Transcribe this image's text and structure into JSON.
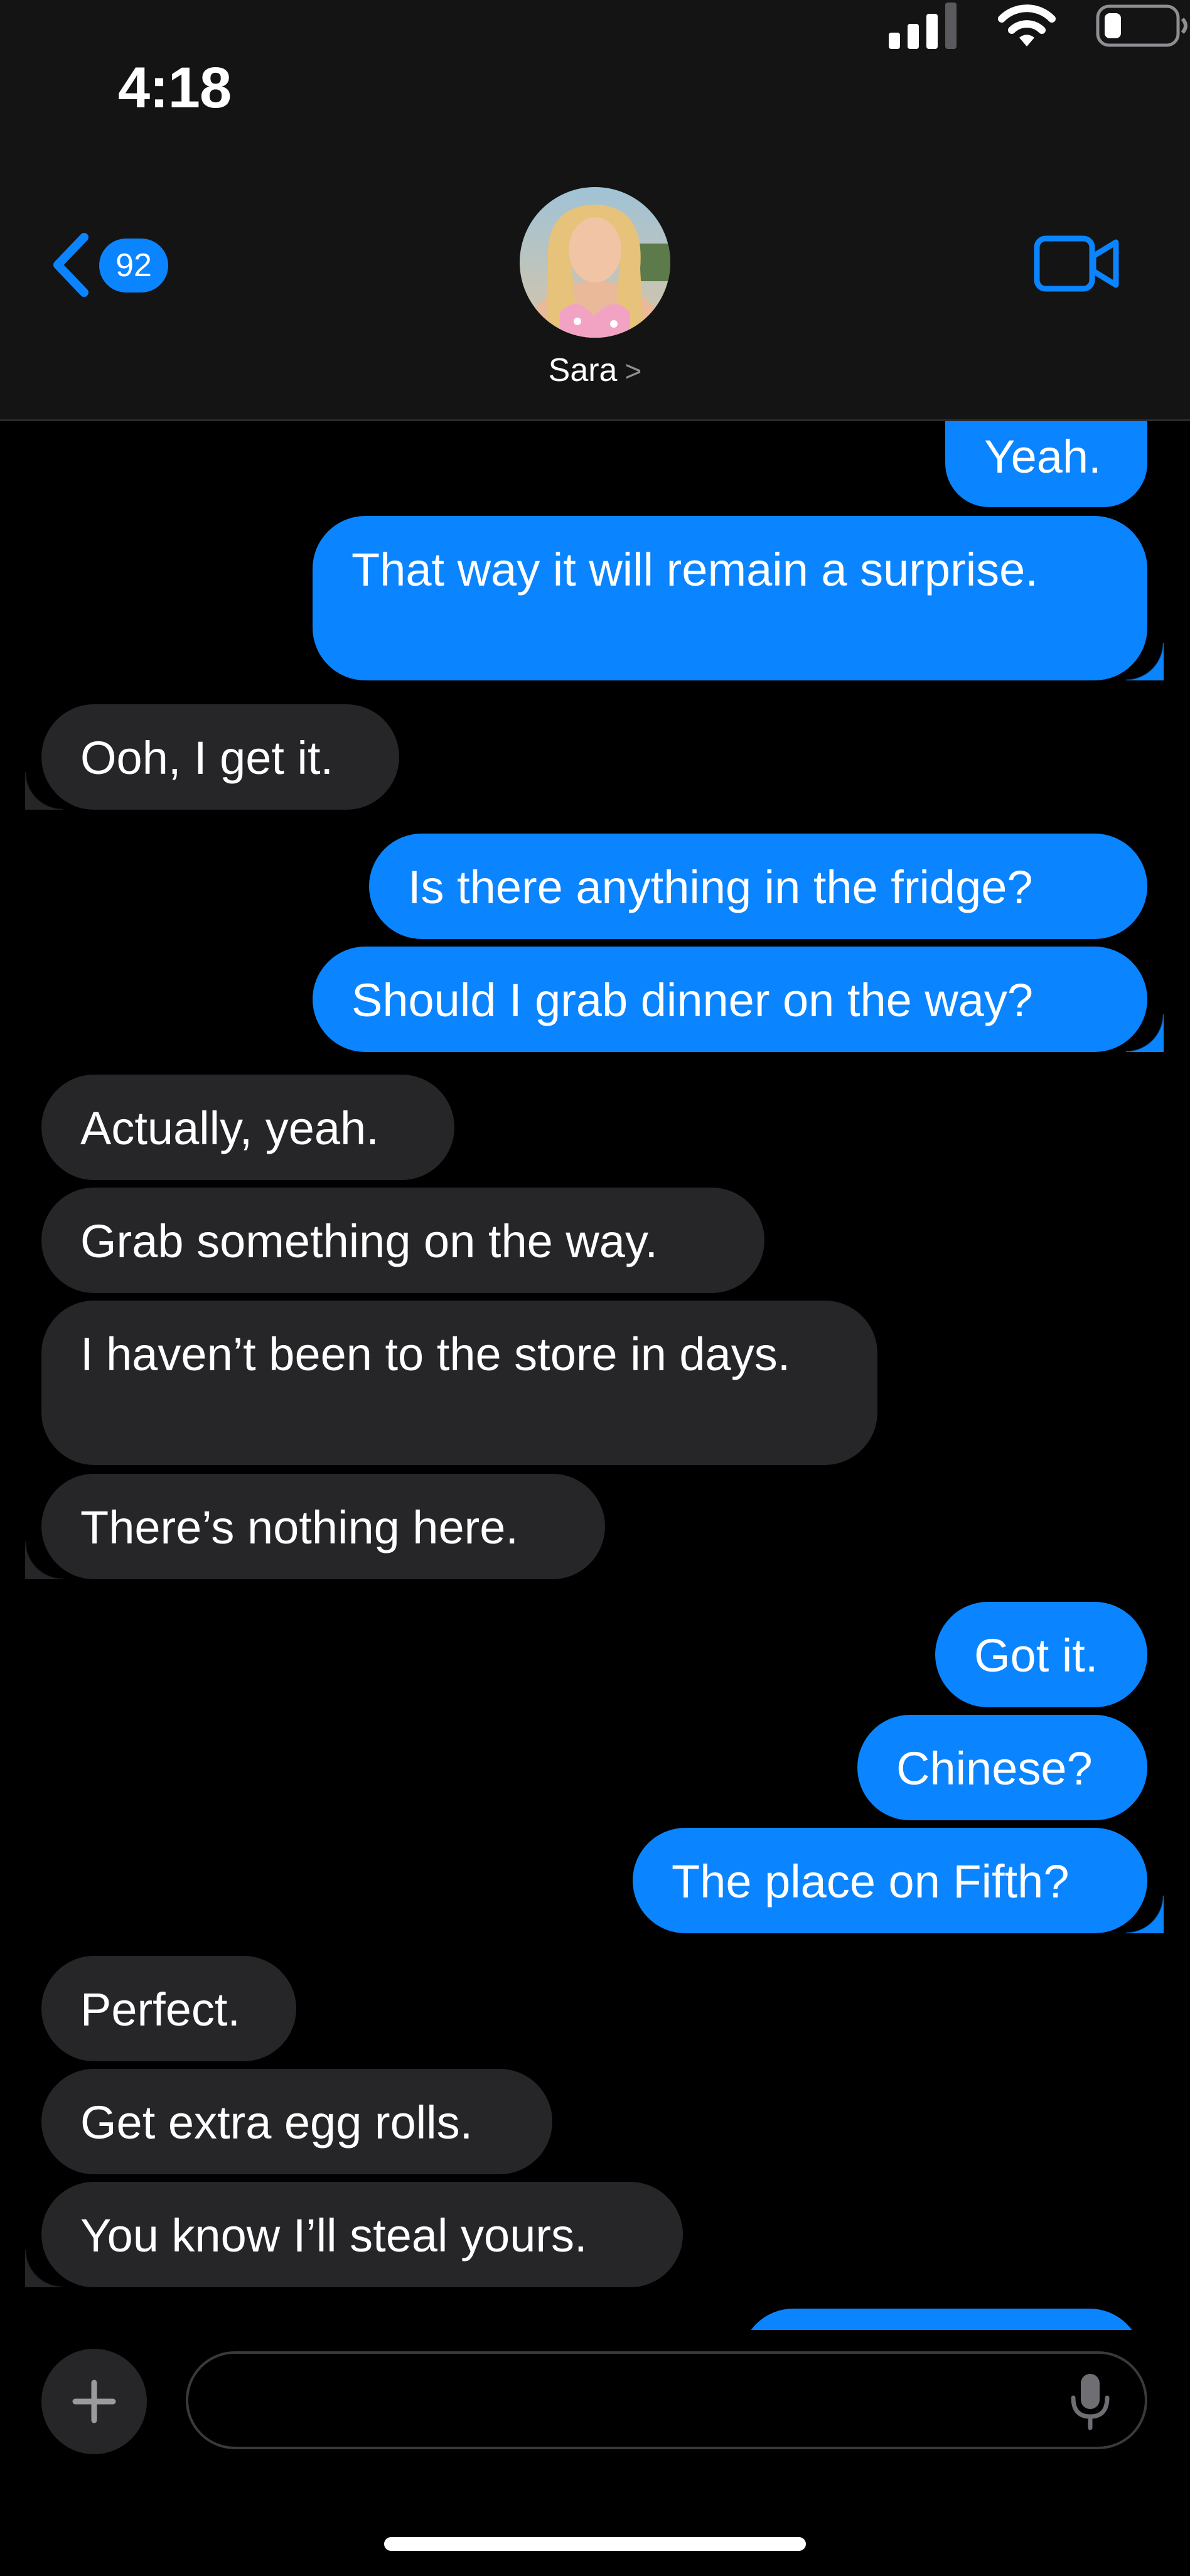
{
  "status_bar": {
    "time": "4:18"
  },
  "header": {
    "unread_count": "92",
    "contact_name": "Sara",
    "contact_chevron": ">",
    "back_icon": "chevron-left-icon",
    "video_icon": "video-camera-icon"
  },
  "messages": [
    {
      "dir": "sent",
      "text": "Yeah."
    },
    {
      "dir": "sent",
      "text": "That way it will remain a surprise."
    },
    {
      "dir": "recv",
      "text": "Ooh, I get it."
    },
    {
      "dir": "sent",
      "text": "Is there anything in the fridge?"
    },
    {
      "dir": "sent",
      "text": "Should I grab dinner on the way?"
    },
    {
      "dir": "recv",
      "text": "Actually, yeah."
    },
    {
      "dir": "recv",
      "text": "Grab something on the way."
    },
    {
      "dir": "recv",
      "text": "I haven’t been to the store in days."
    },
    {
      "dir": "recv",
      "text": "There’s nothing here."
    },
    {
      "dir": "sent",
      "text": "Got it."
    },
    {
      "dir": "sent",
      "text": "Chinese?"
    },
    {
      "dir": "sent",
      "text": "The place on Fifth?"
    },
    {
      "dir": "recv",
      "text": "Perfect."
    },
    {
      "dir": "recv",
      "text": "Get extra egg rolls."
    },
    {
      "dir": "recv",
      "text": "You know I’ll steal yours."
    },
    {
      "dir": "sent",
      "text": ""
    }
  ],
  "composer": {
    "placeholder": "",
    "value": ""
  },
  "colors": {
    "sent_bubble": "#0a84ff",
    "received_bubble": "#262628",
    "background": "#000000",
    "header_background": "#141414"
  }
}
